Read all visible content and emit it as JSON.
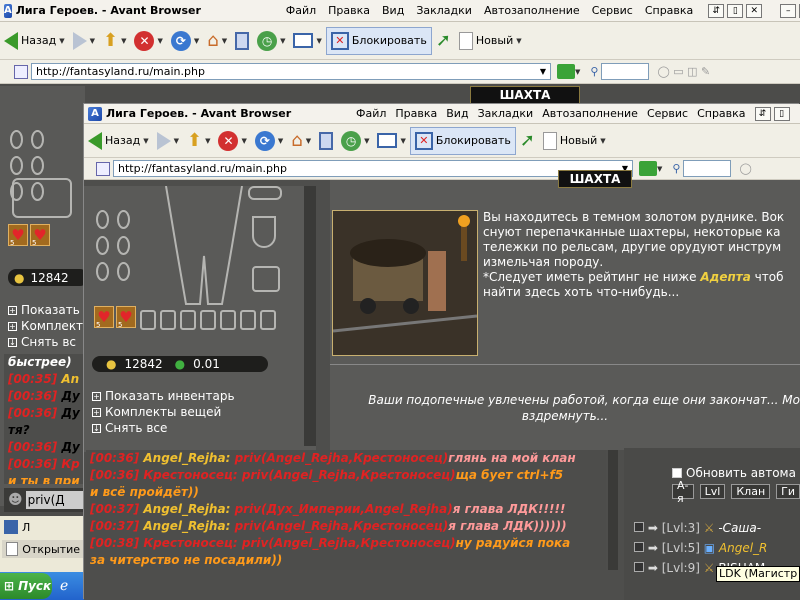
{
  "back_window": {
    "title": "Лига Героев. - Avant Browser",
    "menu": [
      "Файл",
      "Правка",
      "Вид",
      "Закладки",
      "Автозаполнение",
      "Сервис",
      "Справка"
    ],
    "back_label": "Назад",
    "block_label": "Блокировать",
    "new_label": "Новый",
    "url": "http://fantasyland.ru/main.php",
    "location": "ШАХТА",
    "gold": "12842",
    "options": [
      "Показать",
      "Комплект",
      "Снять вс"
    ],
    "chat": [
      {
        "text": "быстрее)"
      },
      {
        "time": "[00:35]",
        "name": "An"
      },
      {
        "time": "[00:36]",
        "name": "Ду"
      },
      {
        "time": "[00:36]",
        "name": "Ду"
      },
      {
        "text": "тя?"
      },
      {
        "time": "[00:36]",
        "name": "Ду"
      },
      {
        "time": "[00:36]",
        "name": "Кр"
      },
      {
        "text": "и ты в при"
      }
    ],
    "chat_input": "priv(Д"
  },
  "front_window": {
    "title": "Лига Героев. - Avant Browser",
    "menu": [
      "Файл",
      "Правка",
      "Вид",
      "Закладки",
      "Автозаполнение",
      "Сервис",
      "Справка"
    ],
    "back_label": "Назад",
    "block_label": "Блокировать",
    "new_label": "Новый",
    "url": "http://fantasyland.ru/main.php",
    "location": "ШАХТА",
    "gold": "12842",
    "rating": "0.01",
    "options": [
      "Показать инвентарь",
      "Комплекты вещей",
      "Снять все"
    ],
    "desc_lines": [
      "Вы находитесь в темном золотом руднике. Вок",
      "снуют перепачканные шахтеры, некоторые ка",
      "тележки по рельсам, другие орудуют инструм",
      "измельчая породу."
    ],
    "req_prefix": "*Следует иметь рейтинг не ниже ",
    "req_rank": "Адепта",
    "req_suffix": " чтоб",
    "req_line2": "найти здесь хоть что-нибудь...",
    "work_line1": "Ваши подопечные увлечены работой, когда еще они закончат... Мо",
    "work_line2": "вздремнуть..."
  },
  "chat_messages": [
    {
      "time": "[00:36]",
      "sender": "Angel_Rejha:",
      "priv": "priv(Angel_Rejha,Крестоносец)",
      "text": "глянь на мой клан"
    },
    {
      "time": "[00:36]",
      "sender": "Крестоносец:",
      "priv": "priv(Angel_Rejha,Крестоносец)",
      "text": "ща бует ctrl+f5"
    },
    {
      "cont": "и всё пройдёт))"
    },
    {
      "time": "[00:37]",
      "sender": "Angel_Rejha:",
      "priv": "priv(Дух_Империи,Angel_Rejha)",
      "text": "я глава ЛДК!!!!!"
    },
    {
      "time": "[00:37]",
      "sender": "Angel_Rejha:",
      "priv": "priv(Angel_Rejha,Крестоносец)",
      "text": "я глава ЛДК))))))"
    },
    {
      "time": "[00:38]",
      "sender": "Крестоносец:",
      "priv": "priv(Angel_Rejha,Крестоносец)",
      "text": "ну радуйся пока"
    },
    {
      "cont": "за читерство не посадили))"
    }
  ],
  "side_panel": {
    "auto_update": "Обновить автома",
    "filters": [
      "А-я",
      "Lvl",
      "Клан",
      "Ги"
    ],
    "players": [
      {
        "level": "[Lvl:3]",
        "name": "-Саша-"
      },
      {
        "level": "[Lvl:5]",
        "name": "Angel_R"
      },
      {
        "level": "[Lvl:9]",
        "name": "BISHAM"
      }
    ],
    "tooltip": "LDK (Магистр - Г"
  },
  "taskbar": {
    "start": "Пуск",
    "items": [
      "Л",
      "Открытие"
    ]
  }
}
